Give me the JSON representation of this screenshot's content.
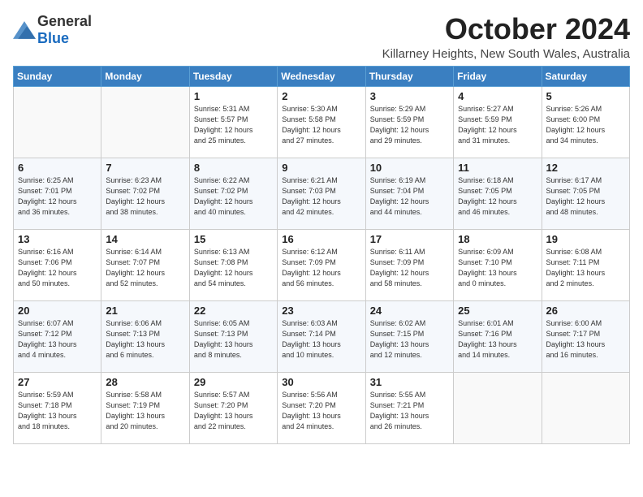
{
  "logo": {
    "general": "General",
    "blue": "Blue"
  },
  "title": "October 2024",
  "location": "Killarney Heights, New South Wales, Australia",
  "days_header": [
    "Sunday",
    "Monday",
    "Tuesday",
    "Wednesday",
    "Thursday",
    "Friday",
    "Saturday"
  ],
  "weeks": [
    [
      {
        "day": "",
        "detail": ""
      },
      {
        "day": "",
        "detail": ""
      },
      {
        "day": "1",
        "detail": "Sunrise: 5:31 AM\nSunset: 5:57 PM\nDaylight: 12 hours\nand 25 minutes."
      },
      {
        "day": "2",
        "detail": "Sunrise: 5:30 AM\nSunset: 5:58 PM\nDaylight: 12 hours\nand 27 minutes."
      },
      {
        "day": "3",
        "detail": "Sunrise: 5:29 AM\nSunset: 5:59 PM\nDaylight: 12 hours\nand 29 minutes."
      },
      {
        "day": "4",
        "detail": "Sunrise: 5:27 AM\nSunset: 5:59 PM\nDaylight: 12 hours\nand 31 minutes."
      },
      {
        "day": "5",
        "detail": "Sunrise: 5:26 AM\nSunset: 6:00 PM\nDaylight: 12 hours\nand 34 minutes."
      }
    ],
    [
      {
        "day": "6",
        "detail": "Sunrise: 6:25 AM\nSunset: 7:01 PM\nDaylight: 12 hours\nand 36 minutes."
      },
      {
        "day": "7",
        "detail": "Sunrise: 6:23 AM\nSunset: 7:02 PM\nDaylight: 12 hours\nand 38 minutes."
      },
      {
        "day": "8",
        "detail": "Sunrise: 6:22 AM\nSunset: 7:02 PM\nDaylight: 12 hours\nand 40 minutes."
      },
      {
        "day": "9",
        "detail": "Sunrise: 6:21 AM\nSunset: 7:03 PM\nDaylight: 12 hours\nand 42 minutes."
      },
      {
        "day": "10",
        "detail": "Sunrise: 6:19 AM\nSunset: 7:04 PM\nDaylight: 12 hours\nand 44 minutes."
      },
      {
        "day": "11",
        "detail": "Sunrise: 6:18 AM\nSunset: 7:05 PM\nDaylight: 12 hours\nand 46 minutes."
      },
      {
        "day": "12",
        "detail": "Sunrise: 6:17 AM\nSunset: 7:05 PM\nDaylight: 12 hours\nand 48 minutes."
      }
    ],
    [
      {
        "day": "13",
        "detail": "Sunrise: 6:16 AM\nSunset: 7:06 PM\nDaylight: 12 hours\nand 50 minutes."
      },
      {
        "day": "14",
        "detail": "Sunrise: 6:14 AM\nSunset: 7:07 PM\nDaylight: 12 hours\nand 52 minutes."
      },
      {
        "day": "15",
        "detail": "Sunrise: 6:13 AM\nSunset: 7:08 PM\nDaylight: 12 hours\nand 54 minutes."
      },
      {
        "day": "16",
        "detail": "Sunrise: 6:12 AM\nSunset: 7:09 PM\nDaylight: 12 hours\nand 56 minutes."
      },
      {
        "day": "17",
        "detail": "Sunrise: 6:11 AM\nSunset: 7:09 PM\nDaylight: 12 hours\nand 58 minutes."
      },
      {
        "day": "18",
        "detail": "Sunrise: 6:09 AM\nSunset: 7:10 PM\nDaylight: 13 hours\nand 0 minutes."
      },
      {
        "day": "19",
        "detail": "Sunrise: 6:08 AM\nSunset: 7:11 PM\nDaylight: 13 hours\nand 2 minutes."
      }
    ],
    [
      {
        "day": "20",
        "detail": "Sunrise: 6:07 AM\nSunset: 7:12 PM\nDaylight: 13 hours\nand 4 minutes."
      },
      {
        "day": "21",
        "detail": "Sunrise: 6:06 AM\nSunset: 7:13 PM\nDaylight: 13 hours\nand 6 minutes."
      },
      {
        "day": "22",
        "detail": "Sunrise: 6:05 AM\nSunset: 7:13 PM\nDaylight: 13 hours\nand 8 minutes."
      },
      {
        "day": "23",
        "detail": "Sunrise: 6:03 AM\nSunset: 7:14 PM\nDaylight: 13 hours\nand 10 minutes."
      },
      {
        "day": "24",
        "detail": "Sunrise: 6:02 AM\nSunset: 7:15 PM\nDaylight: 13 hours\nand 12 minutes."
      },
      {
        "day": "25",
        "detail": "Sunrise: 6:01 AM\nSunset: 7:16 PM\nDaylight: 13 hours\nand 14 minutes."
      },
      {
        "day": "26",
        "detail": "Sunrise: 6:00 AM\nSunset: 7:17 PM\nDaylight: 13 hours\nand 16 minutes."
      }
    ],
    [
      {
        "day": "27",
        "detail": "Sunrise: 5:59 AM\nSunset: 7:18 PM\nDaylight: 13 hours\nand 18 minutes."
      },
      {
        "day": "28",
        "detail": "Sunrise: 5:58 AM\nSunset: 7:19 PM\nDaylight: 13 hours\nand 20 minutes."
      },
      {
        "day": "29",
        "detail": "Sunrise: 5:57 AM\nSunset: 7:20 PM\nDaylight: 13 hours\nand 22 minutes."
      },
      {
        "day": "30",
        "detail": "Sunrise: 5:56 AM\nSunset: 7:20 PM\nDaylight: 13 hours\nand 24 minutes."
      },
      {
        "day": "31",
        "detail": "Sunrise: 5:55 AM\nSunset: 7:21 PM\nDaylight: 13 hours\nand 26 minutes."
      },
      {
        "day": "",
        "detail": ""
      },
      {
        "day": "",
        "detail": ""
      }
    ]
  ]
}
